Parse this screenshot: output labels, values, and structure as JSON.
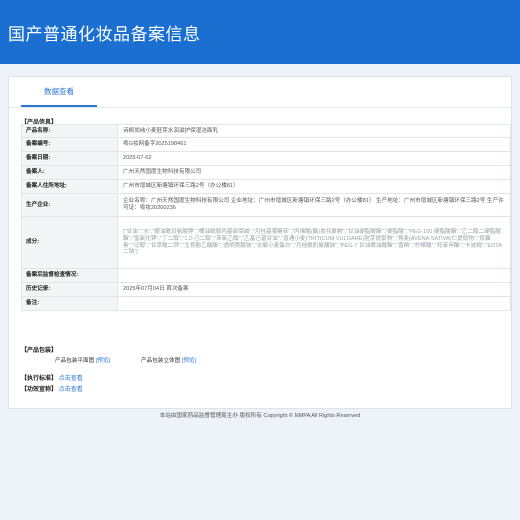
{
  "header": {
    "title": "国产普通化妆品备案信息"
  },
  "tab": {
    "label": "数据查看"
  },
  "product_section": {
    "title": "【产品信息】",
    "rows": [
      {
        "label": "产品名称:",
        "value": "诗枫尚纯小麦胚芽水润滋护保湿洁面乳"
      },
      {
        "label": "备案编号:",
        "value": "粤G妆网备字2025198461"
      },
      {
        "label": "备案日期:",
        "value": "2025-07-02"
      },
      {
        "label": "备案人:",
        "value": "广州天然国度生物科技有限公司"
      },
      {
        "label": "备案人住所地址:",
        "value": "广州市增城区新塘镇环保三路2号（办公楼81）"
      },
      {
        "label": "生产企业:",
        "value": "企业名称：广州天然国度生物科技有限公司 企业地址：广州市增城区新塘镇环保三路2号（办公楼81） 生产地址：广州市增城区新塘镇环保三路2号 生产许可证：粤妆20200236"
      },
      {
        "label": "成分:",
        "value": "[\"甘油\",\"水\",\"椰油酰甘氨酸钾\",\"椰油酰胺丙基甜菜碱\",\"月桂基葡糖苷\",\"丙烯酸(酯)类共聚物\",\"甘油硬脂酸酯\",\"硬脂酸\",\"PEG-100 硬脂酸酯\",\"乙二醇二硬脂酸酯\",\"氢氧化钾\",\"丁二醇\",\"1,2-己二醇\",\"苯氧乙醇\",\"乙基己基甘油\",\"普通小麦(TRITICUM VULGARE)胚芽提取物\",\"燕麦(AVENA SATIVA)仁提取物\",\"尿囊素\",\"泛醇\",\"甘草酸二钾\",\"生育酚乙酸酯\",\"透明质酸钠\",\"水解小麦蛋白\",\"月桂酰肌氨酸钠\",\"PEG-7 甘油椰油酸酯\",\"香精\",\"柠檬酸\",\"羟苯甲酯\",\"卡波姆\",\"EDTA 二钠\"]"
      },
      {
        "label": "备案后监督检查情况:",
        "value": ""
      },
      {
        "label": "历史记录:",
        "value": "2025年07月04日 首次备案"
      },
      {
        "label": "备注:",
        "value": ""
      }
    ]
  },
  "packaging": {
    "title": "【产品包装】",
    "plan_label": "产品包装平面图",
    "plan_link": "[预览]",
    "solid_label": "产品包装立体图",
    "solid_link": "[预览]"
  },
  "standard": {
    "title": "【执行标准】",
    "link": "点击查看"
  },
  "efficacy": {
    "title": "【功效宣称】",
    "link": "点击查看"
  },
  "footer": {
    "text": "本站由国家药品监督管理局主办 版权所有 Copyright © NMPA All Rights Reserved"
  }
}
